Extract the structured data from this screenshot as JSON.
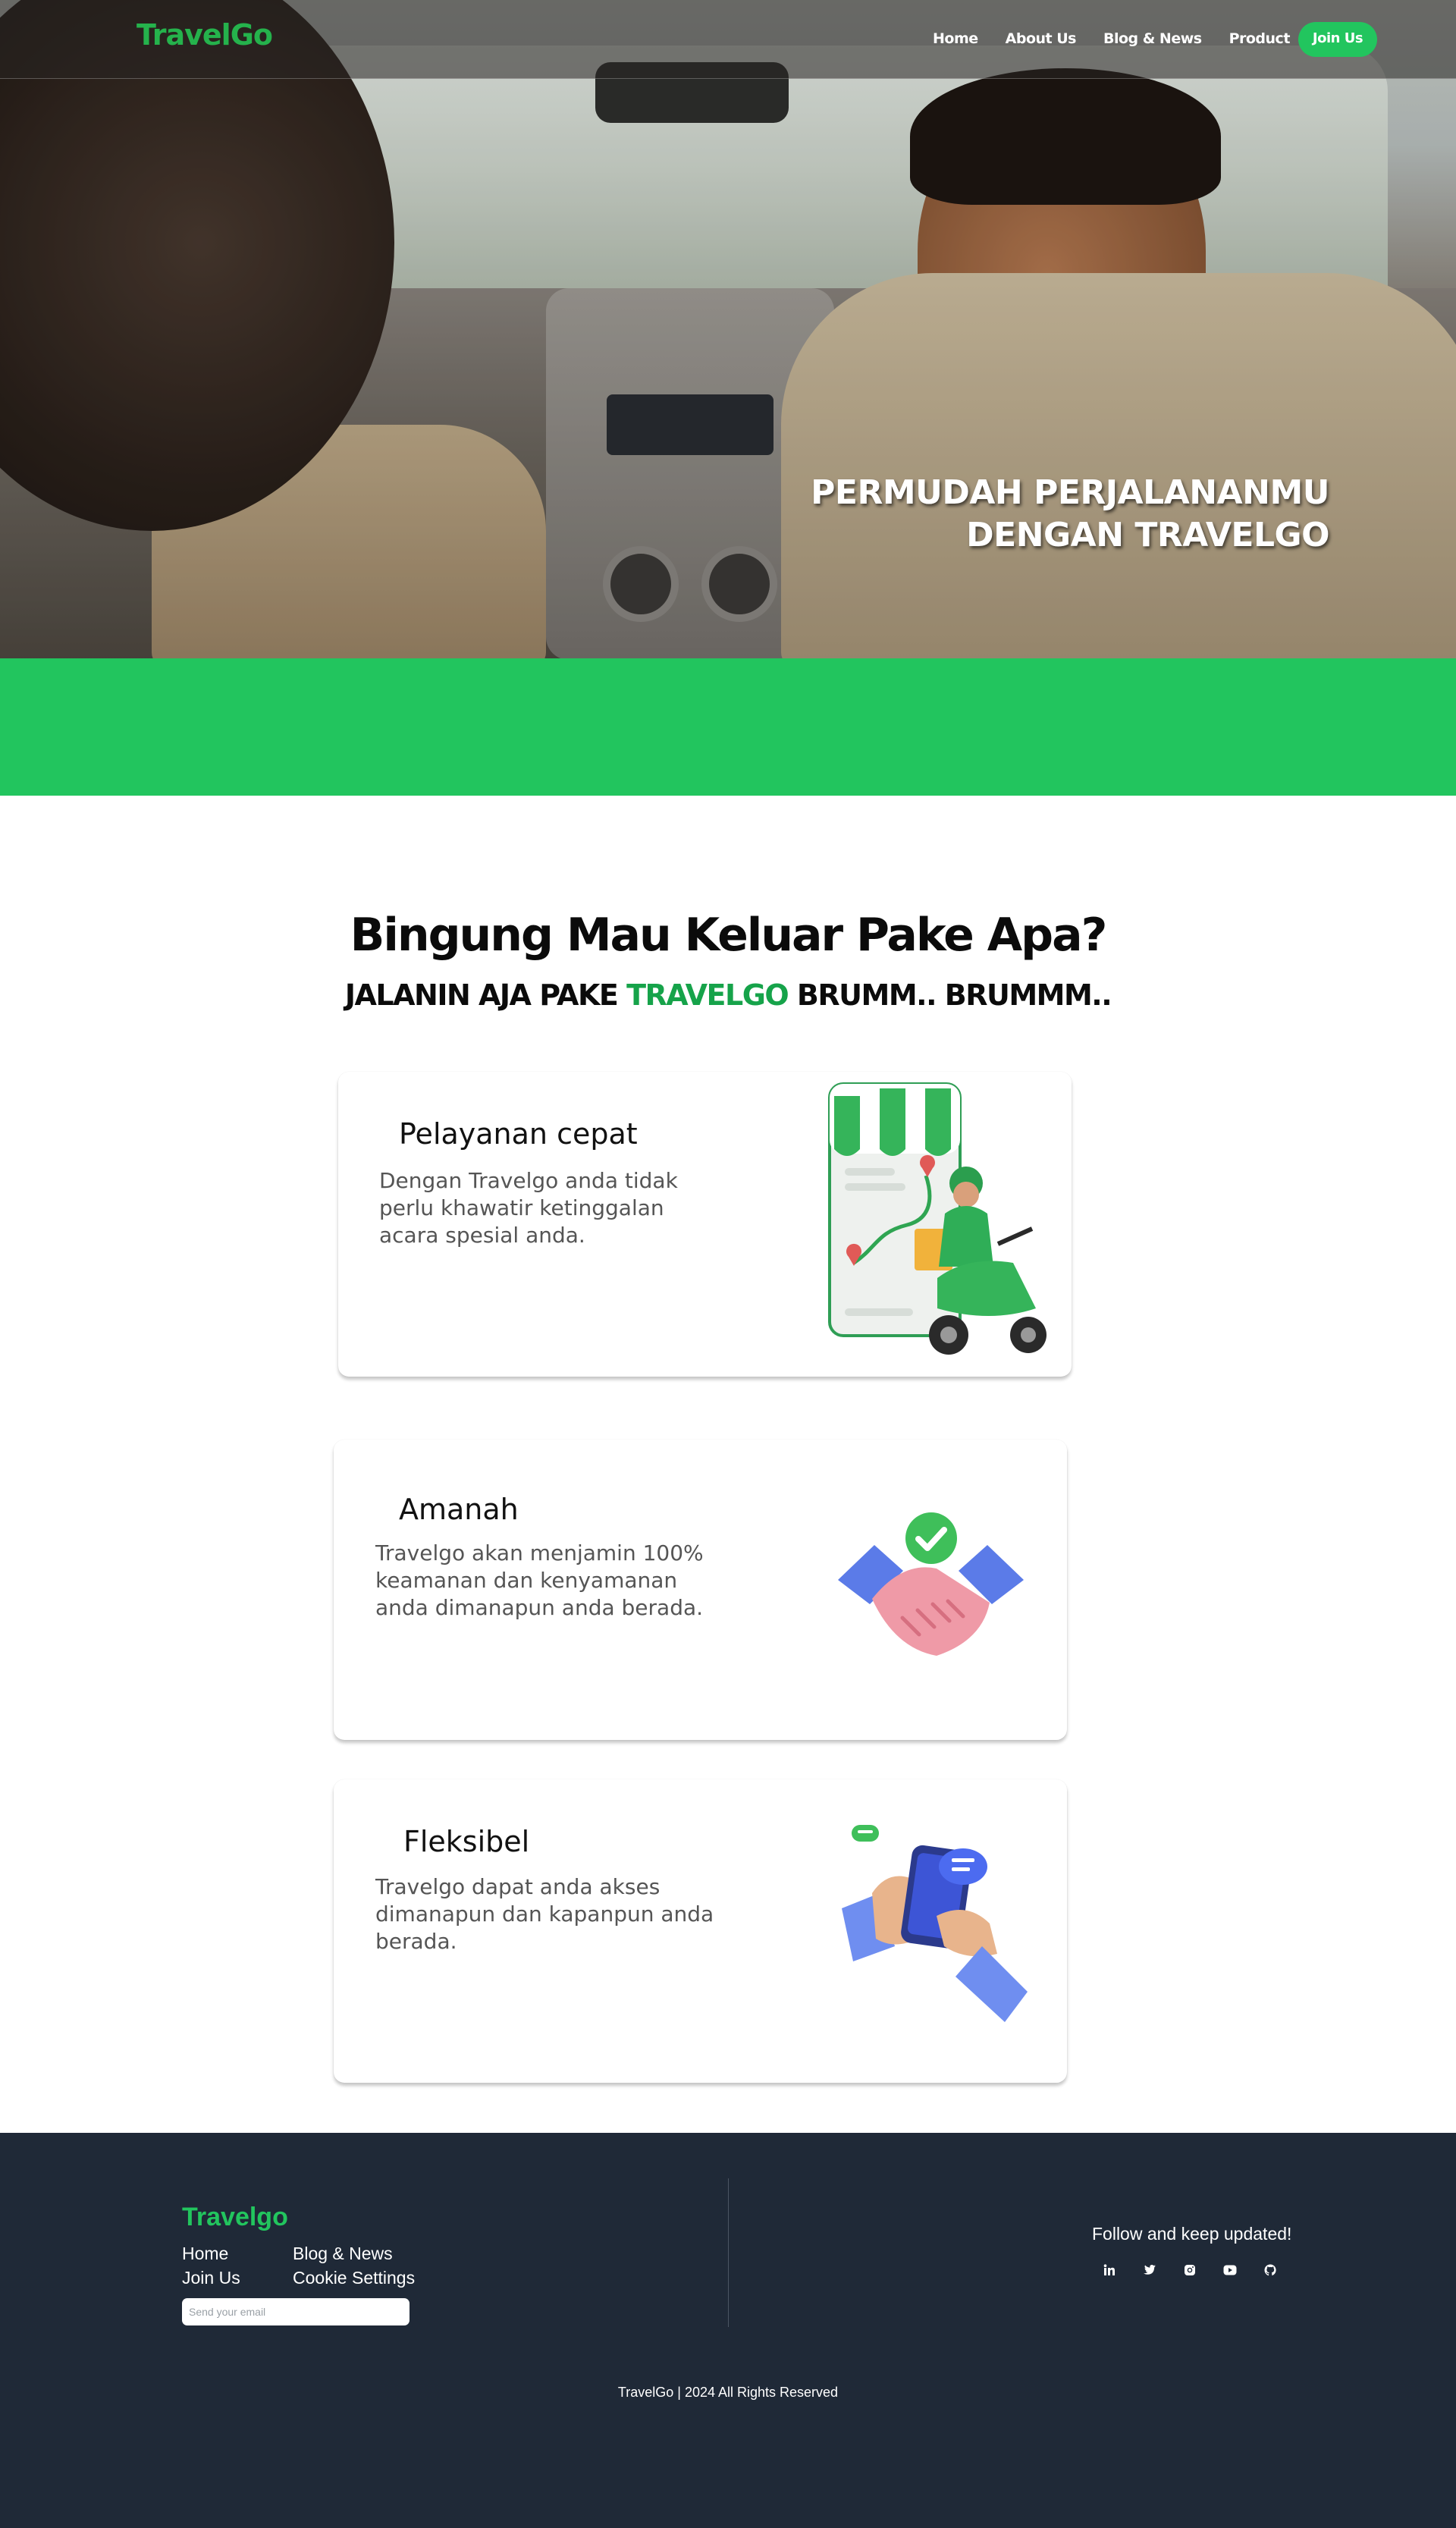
{
  "brand_color": "#22c55e",
  "nav": {
    "brand": "TravelGo",
    "links": [
      "Home",
      "About Us",
      "Blog & News",
      "Product"
    ],
    "join_button": "Join Us"
  },
  "hero": {
    "title_line1": "PERMUDAH PERJALANANMU",
    "title_line2": "DENGAN TRAVELGO"
  },
  "headline": {
    "title": "Bingung Mau Keluar Pake Apa?",
    "subtitle_before": "JALANIN AJA PAKE ",
    "subtitle_accent": "TRAVELGO",
    "subtitle_after": " BRUMM.. BRUMMM.."
  },
  "cards": [
    {
      "title": "Pelayanan cepat",
      "text": "Dengan Travelgo anda tidak perlu khawatir ketinggalan acara spesial anda.",
      "icon": "delivery-scooter-illustration"
    },
    {
      "title": "Amanah",
      "text": "Travelgo akan menjamin 100% keamanan dan kenyamanan anda dimanapun anda berada.",
      "icon": "handshake-check-illustration"
    },
    {
      "title": "Fleksibel",
      "text": "Travelgo dapat anda akses dimanapun dan kapanpun anda berada.",
      "icon": "hand-phone-illustration"
    }
  ],
  "footer": {
    "brand": "Travelgo",
    "links": [
      "Home",
      "Blog & News",
      "Join Us",
      "Cookie Settings"
    ],
    "email_placeholder": "Send your email",
    "follow_text": "Follow and keep updated!",
    "social_icons": [
      "linkedin-icon",
      "twitter-icon",
      "instagram-icon",
      "youtube-icon",
      "github-icon"
    ],
    "copyright": "TravelGo | 2024 All Rights Reserved"
  }
}
